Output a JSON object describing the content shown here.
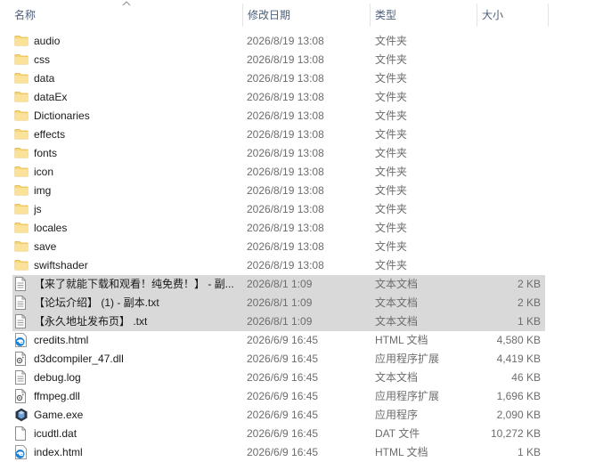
{
  "columns": {
    "name": "名称",
    "date": "修改日期",
    "type": "类型",
    "size": "大小"
  },
  "files": [
    {
      "name": "audio",
      "date": "2026/8/19 13:08",
      "type": "文件夹",
      "size": "",
      "icon": "folder-icon",
      "selected": false
    },
    {
      "name": "css",
      "date": "2026/8/19 13:08",
      "type": "文件夹",
      "size": "",
      "icon": "folder-icon",
      "selected": false
    },
    {
      "name": "data",
      "date": "2026/8/19 13:08",
      "type": "文件夹",
      "size": "",
      "icon": "folder-icon",
      "selected": false
    },
    {
      "name": "dataEx",
      "date": "2026/8/19 13:08",
      "type": "文件夹",
      "size": "",
      "icon": "folder-icon",
      "selected": false
    },
    {
      "name": "Dictionaries",
      "date": "2026/8/19 13:08",
      "type": "文件夹",
      "size": "",
      "icon": "folder-icon",
      "selected": false
    },
    {
      "name": "effects",
      "date": "2026/8/19 13:08",
      "type": "文件夹",
      "size": "",
      "icon": "folder-icon",
      "selected": false
    },
    {
      "name": "fonts",
      "date": "2026/8/19 13:08",
      "type": "文件夹",
      "size": "",
      "icon": "folder-icon",
      "selected": false
    },
    {
      "name": "icon",
      "date": "2026/8/19 13:08",
      "type": "文件夹",
      "size": "",
      "icon": "folder-icon",
      "selected": false
    },
    {
      "name": "img",
      "date": "2026/8/19 13:08",
      "type": "文件夹",
      "size": "",
      "icon": "folder-icon",
      "selected": false
    },
    {
      "name": "js",
      "date": "2026/8/19 13:08",
      "type": "文件夹",
      "size": "",
      "icon": "folder-icon",
      "selected": false
    },
    {
      "name": "locales",
      "date": "2026/8/19 13:08",
      "type": "文件夹",
      "size": "",
      "icon": "folder-icon",
      "selected": false
    },
    {
      "name": "save",
      "date": "2026/8/19 13:08",
      "type": "文件夹",
      "size": "",
      "icon": "folder-icon",
      "selected": false
    },
    {
      "name": "swiftshader",
      "date": "2026/8/19 13:08",
      "type": "文件夹",
      "size": "",
      "icon": "folder-icon",
      "selected": false
    },
    {
      "name": "【来了就能下载和观看！纯免费！】 - 副...",
      "date": "2026/8/1 1:09",
      "type": "文本文档",
      "size": "2 KB",
      "icon": "text-file-icon",
      "selected": true
    },
    {
      "name": "【论坛介绍】 (1) - 副本.txt",
      "date": "2026/8/1 1:09",
      "type": "文本文档",
      "size": "2 KB",
      "icon": "text-file-icon",
      "selected": true
    },
    {
      "name": "【永久地址发布页】 .txt",
      "date": "2026/8/1 1:09",
      "type": "文本文档",
      "size": "1 KB",
      "icon": "text-file-icon",
      "selected": true
    },
    {
      "name": "credits.html",
      "date": "2026/6/9 16:45",
      "type": "HTML 文档",
      "size": "4,580 KB",
      "icon": "edge-html-icon",
      "selected": false
    },
    {
      "name": "d3dcompiler_47.dll",
      "date": "2026/6/9 16:45",
      "type": "应用程序扩展",
      "size": "4,419 KB",
      "icon": "dll-file-icon",
      "selected": false
    },
    {
      "name": "debug.log",
      "date": "2026/6/9 16:45",
      "type": "文本文档",
      "size": "46 KB",
      "icon": "text-file-icon",
      "selected": false
    },
    {
      "name": "ffmpeg.dll",
      "date": "2026/6/9 16:45",
      "type": "应用程序扩展",
      "size": "1,696 KB",
      "icon": "dll-file-icon",
      "selected": false
    },
    {
      "name": "Game.exe",
      "date": "2026/6/9 16:45",
      "type": "应用程序",
      "size": "2,090 KB",
      "icon": "game-exe-icon",
      "selected": false
    },
    {
      "name": "icudtl.dat",
      "date": "2026/6/9 16:45",
      "type": "DAT 文件",
      "size": "10,272 KB",
      "icon": "blank-file-icon",
      "selected": false
    },
    {
      "name": "index.html",
      "date": "2026/6/9 16:45",
      "type": "HTML 文档",
      "size": "1 KB",
      "icon": "edge-html-icon",
      "selected": false
    }
  ]
}
